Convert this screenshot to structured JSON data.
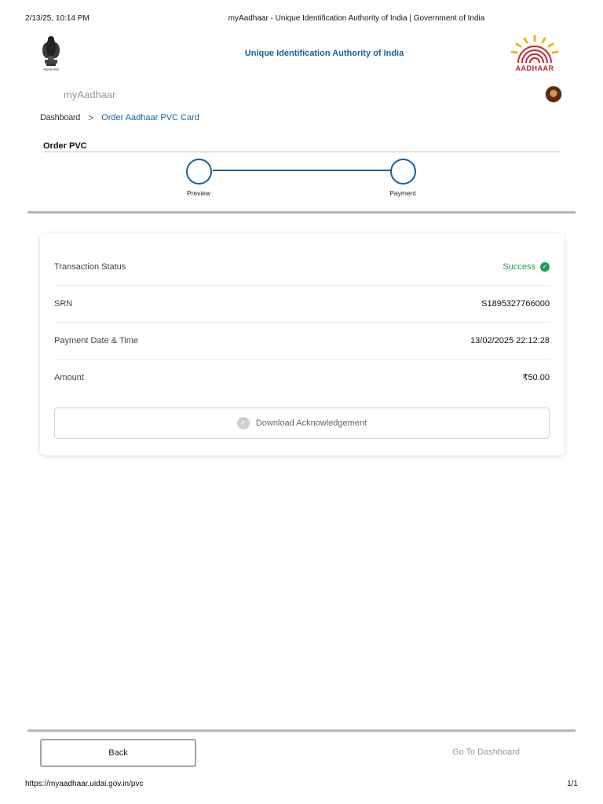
{
  "print_header": {
    "timestamp": "2/13/25, 10:14 PM",
    "page_title": "myAadhaar - Unique Identification Authority of India | Government of India"
  },
  "header": {
    "emblem_caption": "सत्यमेव जयते",
    "org_name": "Unique Identification Authority of India",
    "logo_text": "AADHAAR",
    "logo_colors": {
      "sun": "#f5b21b",
      "fingerprint": "#c0272d"
    }
  },
  "app": {
    "title": "myAadhaar"
  },
  "breadcrumb": {
    "home": "Dashboard",
    "separator": ">",
    "current": "Order Aadhaar PVC Card"
  },
  "section": {
    "title": "Order PVC"
  },
  "stepper": {
    "steps": [
      {
        "label": "Preview"
      },
      {
        "label": "Payment"
      }
    ]
  },
  "transaction": {
    "rows": [
      {
        "label": "Transaction Status",
        "value": "Success"
      },
      {
        "label": "SRN",
        "value": "S1895327766000"
      },
      {
        "label": "Payment Date & Time",
        "value": "13/02/2025 22:12:28"
      },
      {
        "label": "Amount",
        "value": "₹50.00"
      }
    ],
    "download_label": "Download Acknowledgement",
    "success_color": "#1f9d55"
  },
  "footer": {
    "back_label": "Back",
    "dashboard_label": "Go To Dashboard"
  },
  "print_footer": {
    "url": "https://myaadhaar.uidai.gov.in/pvc",
    "page": "1/1"
  },
  "colors": {
    "accent": "#1a5f99",
    "divider": "#aeb8c2"
  }
}
